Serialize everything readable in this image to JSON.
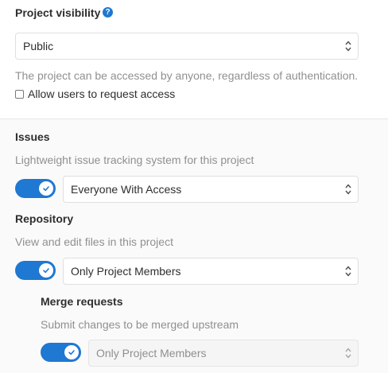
{
  "visibility": {
    "title": "Project visibility",
    "help_glyph": "?",
    "selected": "Public",
    "description": "The project can be accessed by anyone, regardless of authentication.",
    "request_access_label": "Allow users to request access",
    "request_access_checked": false
  },
  "issues": {
    "title": "Issues",
    "description": "Lightweight issue tracking system for this project",
    "enabled": true,
    "selected": "Everyone With Access"
  },
  "repository": {
    "title": "Repository",
    "description": "View and edit files in this project",
    "enabled": true,
    "selected": "Only Project Members"
  },
  "merge_requests": {
    "title": "Merge requests",
    "description": "Submit changes to be merged upstream",
    "enabled": true,
    "selected": "Only Project Members",
    "disabled": true
  },
  "colors": {
    "toggle_on": "#1f78d1",
    "help_text": "#909090",
    "border": "#dfdfdf"
  },
  "icons": {
    "help": "question-circle-icon",
    "caret": "select-caret-icon",
    "check": "check-icon"
  }
}
